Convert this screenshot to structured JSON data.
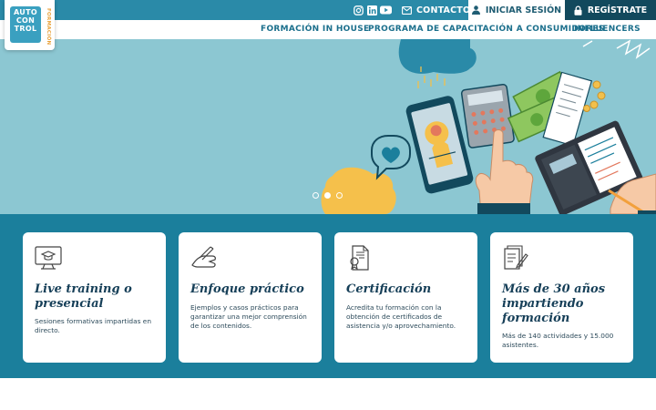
{
  "logo": {
    "lines": [
      "AUTO",
      "CON",
      "TROL"
    ],
    "side": "FORMACIÓN"
  },
  "topbar": {
    "social_icons": [
      "instagram-icon",
      "linkedin-icon",
      "youtube-icon"
    ],
    "contact_label": "CONTACTO",
    "login_label": "INICIAR SESIÓN",
    "register_label": "REGÍSTRATE"
  },
  "nav": {
    "items": [
      {
        "label": "FORMACIÓN IN HOUSE"
      },
      {
        "label": "PROGRAMA DE CAPACITACIÓN A CONSUMIDORES"
      },
      {
        "label": "INFLUENCERS"
      }
    ]
  },
  "hero": {
    "slides_total": 3,
    "active_slide": 2
  },
  "features": [
    {
      "icon": "computer-graduation-icon",
      "title": "Live training o presencial",
      "desc": "Sesiones formativas impartidas en directo."
    },
    {
      "icon": "hand-writing-icon",
      "title": "Enfoque práctico",
      "desc": "Ejemplos y casos prácticos para garantizar una mejor comprensión de los contenidos."
    },
    {
      "icon": "certificate-icon",
      "title": "Certificación",
      "desc": "Acredita tu formación con la obtención de certificados de asistencia y/o aprovechamiento."
    },
    {
      "icon": "documents-pen-icon",
      "title": "Más de 30 años impartiendo formación",
      "desc": "Más de 140 actividades y 15.000 asistentes."
    }
  ],
  "colors": {
    "topbar": "#2a8aa8",
    "register": "#12495d",
    "nav_text": "#1b6f8c",
    "hero_bg": "#8cc7d2",
    "features_bg": "#1b7f9c",
    "title": "#163f58"
  }
}
